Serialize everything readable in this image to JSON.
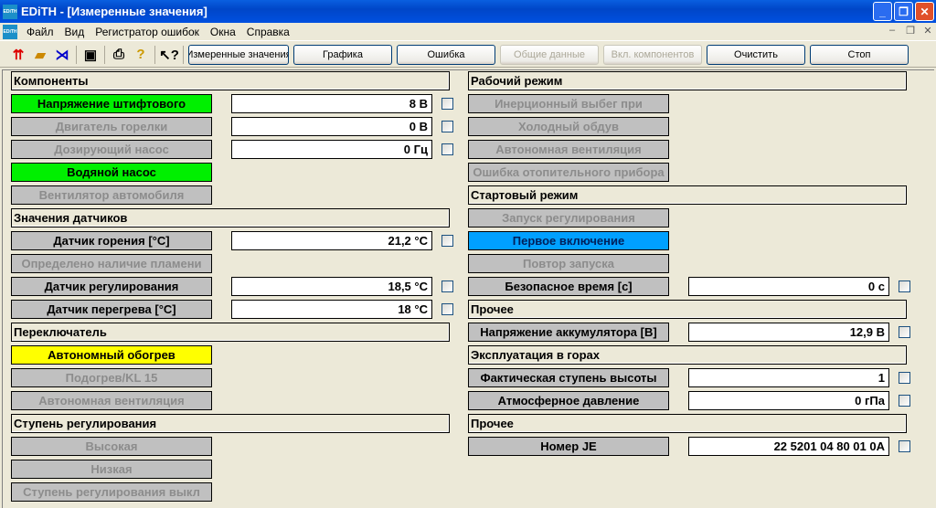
{
  "window": {
    "title": "EDiTH - [Измеренные значения]",
    "app_icon": "EDiTH"
  },
  "menu": [
    "Файл",
    "Вид",
    "Регистратор ошибок",
    "Окна",
    "Справка"
  ],
  "toolbar": {
    "icons": [
      "connect-icon",
      "open-folder-icon",
      "antenna-icon",
      "save-icon",
      "print-icon",
      "help-icon",
      "context-help-icon"
    ],
    "buttons": [
      {
        "label": "Измеренные значения",
        "enabled": true
      },
      {
        "label": "Графика",
        "enabled": true
      },
      {
        "label": "Ошибка",
        "enabled": true
      },
      {
        "label": "Общие данные",
        "enabled": false
      },
      {
        "label": "Вкл. компонентов",
        "enabled": false
      },
      {
        "label": "Очистить",
        "enabled": true
      },
      {
        "label": "Стоп",
        "enabled": true
      }
    ]
  },
  "left": [
    {
      "type": "header",
      "label": "Компоненты"
    },
    {
      "label": "Напряжение штифтового",
      "state": "green",
      "value": "8 В"
    },
    {
      "label": "Двигатель горелки",
      "state": "disabled",
      "value": "0 В"
    },
    {
      "label": "Дозирующий насос",
      "state": "disabled",
      "value": "0 Гц"
    },
    {
      "label": "Водяной насос",
      "state": "green"
    },
    {
      "label": "Вентилятор автомобиля",
      "state": "disabled"
    },
    {
      "type": "header",
      "label": "Значения датчиков"
    },
    {
      "label": "Датчик горения [°C]",
      "state": "active",
      "value": "21,2 °C"
    },
    {
      "label": "Определено наличие пламени",
      "state": "disabled"
    },
    {
      "label": "Датчик регулирования",
      "state": "active",
      "value": "18,5 °C"
    },
    {
      "label": "Датчик перегрева [°C]",
      "state": "active",
      "value": "18 °C"
    },
    {
      "type": "header",
      "label": "Переключатель"
    },
    {
      "label": "Автономный обогрев",
      "state": "yellow"
    },
    {
      "label": "Подогрев/KL 15",
      "state": "disabled"
    },
    {
      "label": "Автономная вентиляция",
      "state": "disabled"
    },
    {
      "type": "header",
      "label": "Ступень регулирования"
    },
    {
      "label": "Высокая",
      "state": "disabled"
    },
    {
      "label": "Низкая",
      "state": "disabled"
    },
    {
      "label": "Ступень регулирования выкл",
      "state": "disabled"
    }
  ],
  "right": [
    {
      "type": "header",
      "label": "Рабочий режим"
    },
    {
      "label": "Инерционный выбег при",
      "state": "disabled"
    },
    {
      "label": "Холодный обдув",
      "state": "disabled"
    },
    {
      "label": "Автономная вентиляция",
      "state": "disabled"
    },
    {
      "label": "Ошибка отопительного прибора",
      "state": "disabled"
    },
    {
      "type": "header",
      "label": "Стартовый режим"
    },
    {
      "label": "Запуск регулирования",
      "state": "disabled"
    },
    {
      "label": "Первое включение",
      "state": "blue"
    },
    {
      "label": "Повтор запуска",
      "state": "disabled"
    },
    {
      "label": "Безопасное время [c]",
      "state": "active",
      "value": "0 c"
    },
    {
      "type": "header",
      "label": "Прочее"
    },
    {
      "label": "Напряжение аккумулятора [В]",
      "state": "active",
      "value": "12,9 В"
    },
    {
      "type": "header",
      "label": "Эксплуатация в горах"
    },
    {
      "label": "Фактическая ступень высоты",
      "state": "active",
      "value": "1"
    },
    {
      "label": "Атмосферное давление",
      "state": "active",
      "value": "0 гПа"
    },
    {
      "type": "header",
      "label": "Прочее"
    },
    {
      "label": "Номер JE",
      "state": "active",
      "value": "22 5201 04 80 01 0A"
    }
  ]
}
